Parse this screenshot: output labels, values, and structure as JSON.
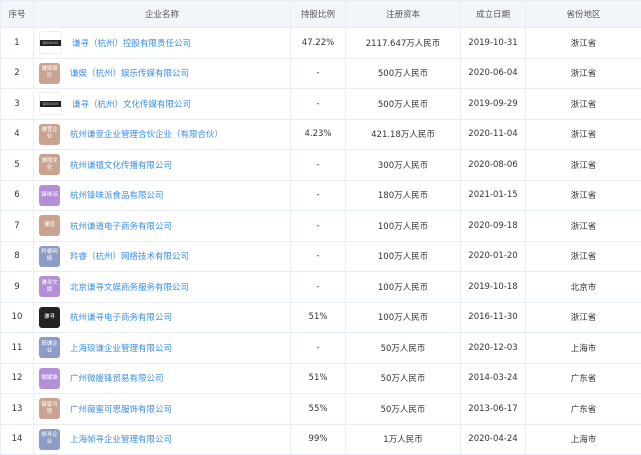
{
  "headers": [
    "序号",
    "企业名称",
    "持股比例",
    "注册资本",
    "成立日期",
    "省份地区"
  ],
  "rows": [
    {
      "no": "1",
      "logo": "qianxun",
      "logo_style": "bar",
      "logo_color": "#222222",
      "name": "谦寻（杭州）控股有限责任公司",
      "ratio": "47.22%",
      "capital": "2117.647万人民币",
      "date": "2019-10-31",
      "region": "浙江省"
    },
    {
      "no": "2",
      "logo": "谦娱娱乐",
      "logo_style": "box",
      "logo_color": "#c9a390",
      "name": "谦娱（杭州）娱乐传媒有限公司",
      "ratio": "-",
      "capital": "500万人民币",
      "date": "2020-06-04",
      "region": "浙江省"
    },
    {
      "no": "3",
      "logo": "qianxun",
      "logo_style": "bar",
      "logo_color": "#222222",
      "name": "谦寻（杭州）文化传媒有限公司",
      "ratio": "-",
      "capital": "500万人民币",
      "date": "2019-09-29",
      "region": "浙江省"
    },
    {
      "no": "4",
      "logo": "谦萱企业",
      "logo_style": "box",
      "logo_color": "#c9a390",
      "name": "杭州谦萱企业管理合伙企业（有限合伙）",
      "ratio": "4.23%",
      "capital": "421.18万人民币",
      "date": "2020-11-04",
      "region": "浙江省"
    },
    {
      "no": "5",
      "logo": "谦禧文化",
      "logo_style": "box",
      "logo_color": "#c9a390",
      "name": "杭州谦禧文化传播有限公司",
      "ratio": "-",
      "capital": "300万人民币",
      "date": "2020-08-06",
      "region": "浙江省"
    },
    {
      "no": "6",
      "logo": "锋味派",
      "logo_style": "box",
      "logo_color": "#b38fd8",
      "name": "杭州锋味派食品有限公司",
      "ratio": "-",
      "capital": "180万人民币",
      "date": "2021-01-15",
      "region": "浙江省"
    },
    {
      "no": "7",
      "logo": "谦道",
      "logo_style": "box",
      "logo_color": "#c9a390",
      "name": "杭州谦道电子商务有限公司",
      "ratio": "-",
      "capital": "100万人民币",
      "date": "2020-09-18",
      "region": "浙江省"
    },
    {
      "no": "8",
      "logo": "羚睿网络",
      "logo_style": "box",
      "logo_color": "#8c9cc6",
      "name": "羚睿（杭州）网络技术有限公司",
      "ratio": "-",
      "capital": "100万人民币",
      "date": "2020-01-20",
      "region": "浙江省"
    },
    {
      "no": "9",
      "logo": "谦寻文娱",
      "logo_style": "box",
      "logo_color": "#b38fd8",
      "name": "北京谦寻文娱商务服务有限公司",
      "ratio": "-",
      "capital": "100万人民币",
      "date": "2019-10-18",
      "region": "北京市"
    },
    {
      "no": "10",
      "logo": "谦寻",
      "logo_style": "box",
      "logo_color": "#222222",
      "name": "杭州谦寻电子商务有限公司",
      "ratio": "51%",
      "capital": "100万人民币",
      "date": "2016-11-30",
      "region": "浙江省"
    },
    {
      "no": "11",
      "logo": "琅谦企业",
      "logo_style": "box",
      "logo_color": "#8c9cc6",
      "name": "上海琅谦企业管理有限公司",
      "ratio": "-",
      "capital": "50万人民币",
      "date": "2020-12-03",
      "region": "上海市"
    },
    {
      "no": "12",
      "logo": "微媛锋",
      "logo_style": "box",
      "logo_color": "#b38fd8",
      "name": "广州微媛锋贸易有限公司",
      "ratio": "51%",
      "capital": "50万人民币",
      "date": "2014-03-24",
      "region": "广东省"
    },
    {
      "no": "13",
      "logo": "薇蜜可思",
      "logo_style": "box",
      "logo_color": "#c9a390",
      "name": "广州薇蜜可思服饰有限公司",
      "ratio": "55%",
      "capital": "50万人民币",
      "date": "2013-06-17",
      "region": "广东省"
    },
    {
      "no": "14",
      "logo": "帧寻企业",
      "logo_style": "box",
      "logo_color": "#8c9cc6",
      "name": "上海帧寻企业管理有限公司",
      "ratio": "99%",
      "capital": "1万人民币",
      "date": "2020-04-24",
      "region": "上海市"
    }
  ]
}
